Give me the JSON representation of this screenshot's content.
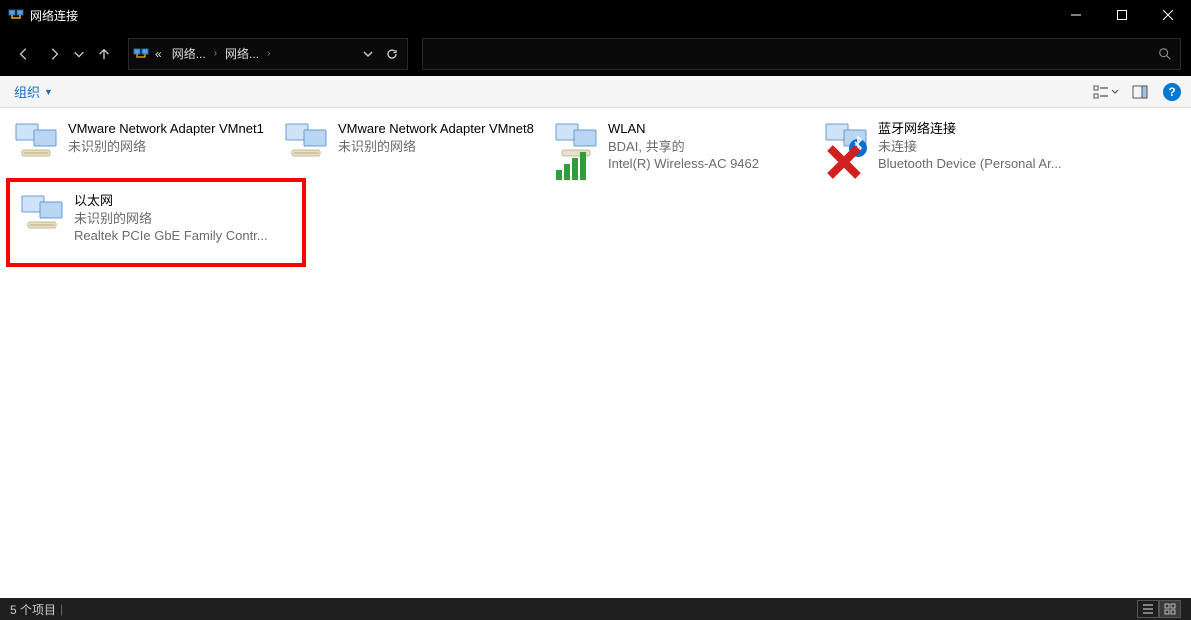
{
  "title": "网络连接",
  "breadcrumbs": {
    "a": "«",
    "b": "网络...",
    "c": "网络..."
  },
  "search_placeholder": "",
  "cmdbar": {
    "organize": "组织"
  },
  "items": [
    {
      "name": "VMware Network Adapter VMnet1",
      "status": "未识别的网络",
      "device": "",
      "type": "eth",
      "overlay": "none"
    },
    {
      "name": "VMware Network Adapter VMnet8",
      "status": "未识别的网络",
      "device": "",
      "type": "eth",
      "overlay": "none"
    },
    {
      "name": "WLAN",
      "status": "BDAI, 共享的",
      "device": "Intel(R) Wireless-AC 9462",
      "type": "wifi",
      "overlay": "signal"
    },
    {
      "name": "蓝牙网络连接",
      "status": "未连接",
      "device": "Bluetooth Device (Personal Ar...",
      "type": "bt",
      "overlay": "x"
    },
    {
      "name": "以太网",
      "status": "未识别的网络",
      "device": "Realtek PCIe GbE Family Contr...",
      "type": "eth",
      "overlay": "none",
      "highlight": true
    }
  ],
  "statusbar": {
    "count": "5 个项目"
  }
}
